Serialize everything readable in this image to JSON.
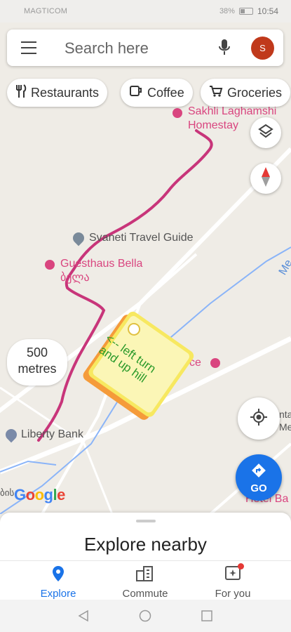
{
  "status_bar": {
    "carrier": "MAGTICOM",
    "battery": "38%",
    "time": "10:54"
  },
  "search": {
    "placeholder": "Search here",
    "avatar_initial": "S"
  },
  "chips": [
    {
      "label": "Restaurants",
      "icon": "fork-knife-icon"
    },
    {
      "label": "Coffee",
      "icon": "coffee-cup-icon"
    },
    {
      "label": "Groceries",
      "icon": "cart-icon"
    }
  ],
  "map": {
    "places": {
      "homestay_line1": "Sakhli Laghamshi",
      "homestay_line2": "Homestay",
      "svaneti": "Svaneti Travel Guide",
      "guesthaus_line1": "Guesthaus Bella",
      "guesthaus_line2": "ბელა",
      "liberty": "Liberty Bank",
      "hotel_partial": "Hotel Ba",
      "right_partial_1": "Me",
      "right_partial_2": "ce",
      "right_partial_3": "nta",
      "right_partial_4": "Me",
      "left_partial": "ბის"
    },
    "scale": {
      "value": "500",
      "unit": "metres"
    },
    "note": {
      "line1": "<-- left turn",
      "line2": "and up hill"
    },
    "logo": "Google",
    "route_color": "#c8357a"
  },
  "go_button": {
    "label": "GO"
  },
  "bottom_sheet": {
    "title": "Explore nearby"
  },
  "nav": {
    "explore": "Explore",
    "commute": "Commute",
    "for_you": "For you"
  },
  "colors": {
    "accent": "#1a73e8",
    "poi": "#d9457f",
    "avatar": "#c0391b"
  }
}
